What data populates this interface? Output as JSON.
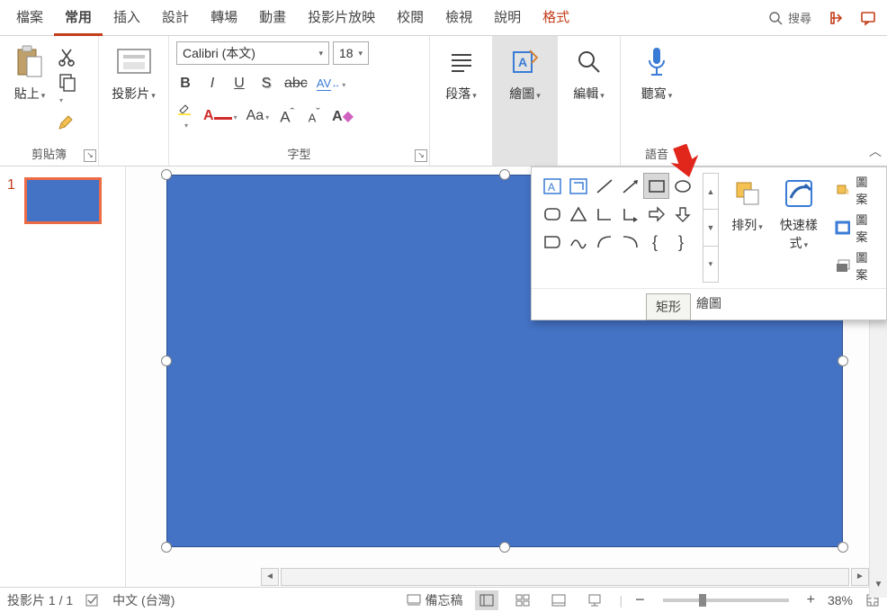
{
  "tabs": {
    "file": "檔案",
    "home": "常用",
    "insert": "插入",
    "design": "設計",
    "transitions": "轉場",
    "animations": "動畫",
    "slideshow": "投影片放映",
    "review": "校閱",
    "view": "檢視",
    "help": "說明",
    "format": "格式",
    "search": "搜尋"
  },
  "ribbon": {
    "clipboard": {
      "paste": "貼上",
      "group": "剪貼簿"
    },
    "slides": {
      "label": "投影片"
    },
    "font": {
      "name": "Calibri (本文)",
      "size": "18",
      "group": "字型",
      "bold": "B",
      "italic": "I",
      "underline": "U",
      "shadow": "S",
      "strike": "abc",
      "spacing": "AV",
      "caseLabel": "Aa",
      "growA": "A",
      "growCaret": "ˆ",
      "shrinkA": "A",
      "shrinkCaret": "ˇ"
    },
    "paragraph": {
      "label": "段落"
    },
    "drawing": {
      "label": "繪圖"
    },
    "editing": {
      "label": "編輯"
    },
    "dictate": {
      "label": "聽寫"
    },
    "voice": {
      "label": "語音"
    }
  },
  "draw_panel": {
    "arrange": "排列",
    "quickstyles": "快速樣式",
    "fill": "圖案",
    "outline": "圖案",
    "effects": "圖案",
    "group": "繪圖"
  },
  "tooltip": "矩形",
  "thumb_number": "1",
  "status": {
    "slide": "投影片 1 / 1",
    "lang": "中文 (台灣)",
    "notes": "備忘稿",
    "zoom": "38%",
    "minus": "−",
    "plus": "+"
  }
}
